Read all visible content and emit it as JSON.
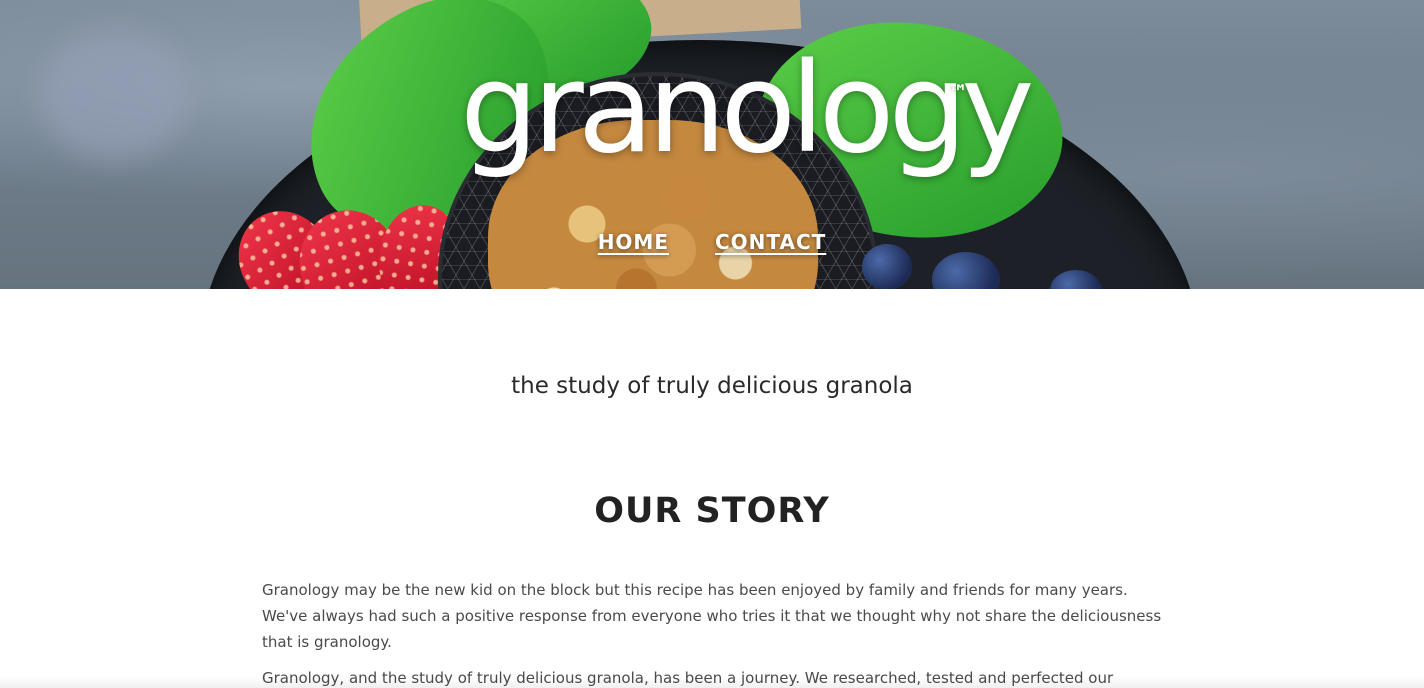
{
  "header": {
    "logo_text": "granology",
    "trademark": "™",
    "nav": [
      {
        "label": "HOME"
      },
      {
        "label": "CONTACT"
      }
    ]
  },
  "main": {
    "tagline": "the study of truly delicious granola",
    "story_title": "OUR STORY",
    "paragraphs": [
      "Granology may be the new kid on the block but this recipe has been enjoyed by family and friends for many years. We've always had such a positive response from everyone who tries it that we thought why not share the deliciousness that is granology.",
      "Granology, and the study of truly delicious granola, has been a journey. We researched, tested and perfected our recipe."
    ]
  }
}
